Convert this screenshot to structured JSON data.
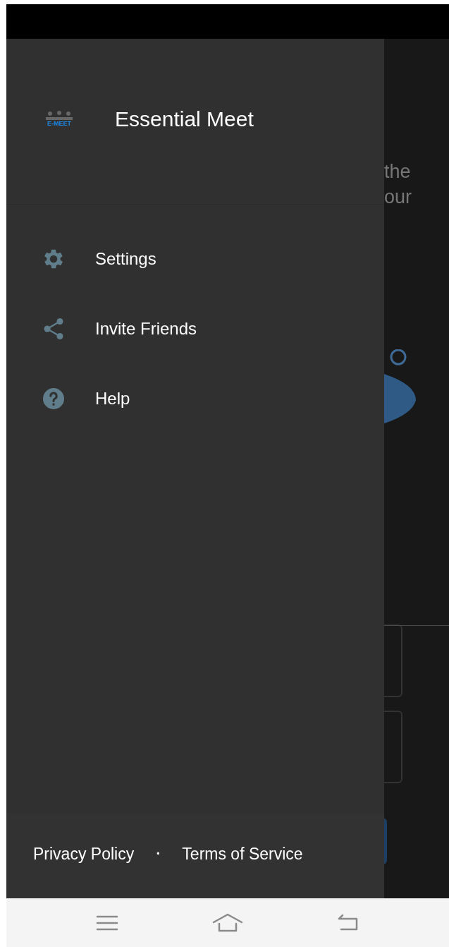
{
  "drawer": {
    "app_name": "Essential Meet",
    "logo_text": "E-MEET",
    "menu": [
      {
        "kind": "settings",
        "label": "Settings"
      },
      {
        "kind": "share",
        "label": "Invite Friends"
      },
      {
        "kind": "help",
        "label": "Help"
      }
    ],
    "footer_links": [
      "Privacy Policy",
      "Terms of Service"
    ],
    "separator": "•"
  },
  "background": {
    "text_lines": [
      "the",
      "our"
    ]
  },
  "nav_bar": [
    {
      "kind": "menu"
    },
    {
      "kind": "home"
    },
    {
      "kind": "back"
    }
  ]
}
